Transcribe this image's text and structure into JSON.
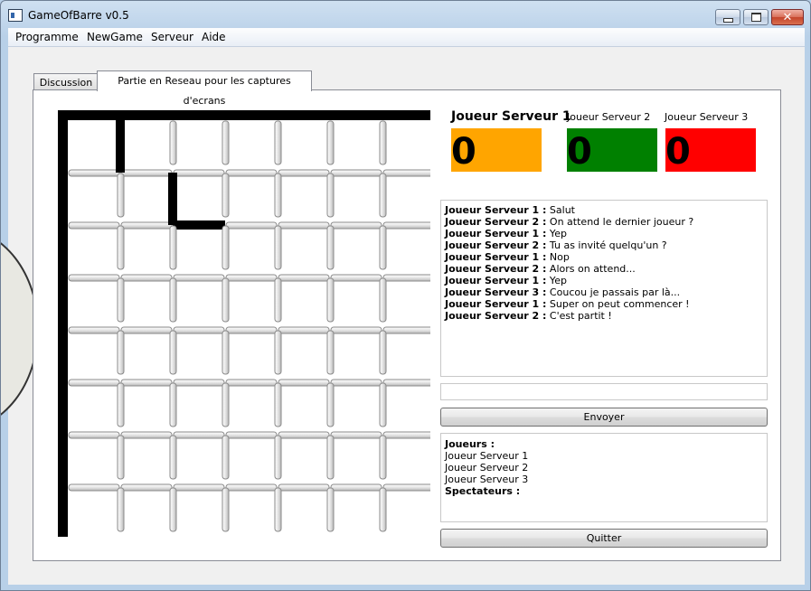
{
  "window": {
    "title": "GameOfBarre v0.5"
  },
  "menu": [
    "Programme",
    "NewGame",
    "Serveur",
    "Aide"
  ],
  "tabs": [
    {
      "label": "Discussion",
      "active": false
    },
    {
      "label": "Partie en Reseau pour les captures d'ecrans",
      "active": true
    }
  ],
  "players": [
    {
      "name": "Joueur Serveur 1",
      "score": "0",
      "color": "#ffa500"
    },
    {
      "name": "Joueur Serveur 2",
      "score": "0",
      "color": "#008000"
    },
    {
      "name": "Joueur Serveur 3",
      "score": "0",
      "color": "#ff0000"
    }
  ],
  "chat": [
    {
      "author": "Joueur Serveur 1 :",
      "text": " Salut"
    },
    {
      "author": "Joueur Serveur 2 :",
      "text": " On attend le dernier joueur ?"
    },
    {
      "author": "Joueur Serveur 1 :",
      "text": " Yep"
    },
    {
      "author": "Joueur Serveur 2 :",
      "text": " Tu as invité quelqu'un ?"
    },
    {
      "author": "Joueur Serveur 1 :",
      "text": " Nop"
    },
    {
      "author": "Joueur Serveur 2 :",
      "text": " Alors on attend..."
    },
    {
      "author": "Joueur Serveur 1 :",
      "text": " Yep"
    },
    {
      "author": "Joueur Serveur 3 :",
      "text": " Coucou je passais par là..."
    },
    {
      "author": "Joueur Serveur 1 :",
      "text": " Super on peut commencer !"
    },
    {
      "author": "Joueur Serveur 2 :",
      "text": " C'est partit !"
    }
  ],
  "chat_input": {
    "value": ""
  },
  "buttons": {
    "send": "Envoyer",
    "quit": "Quitter"
  },
  "roster": {
    "players_heading": "Joueurs :",
    "players": [
      "Joueur Serveur 1",
      "Joueur Serveur 2",
      "Joueur Serveur 3"
    ],
    "spectators_heading": "Spectateurs :",
    "spectators": []
  },
  "board": {
    "cols": 7,
    "rows": 8,
    "played_bars": [
      {
        "type": "v",
        "col": 1,
        "row": 0
      },
      {
        "type": "v",
        "col": 2,
        "row": 1
      },
      {
        "type": "h",
        "col": 2,
        "row": 2
      }
    ]
  }
}
